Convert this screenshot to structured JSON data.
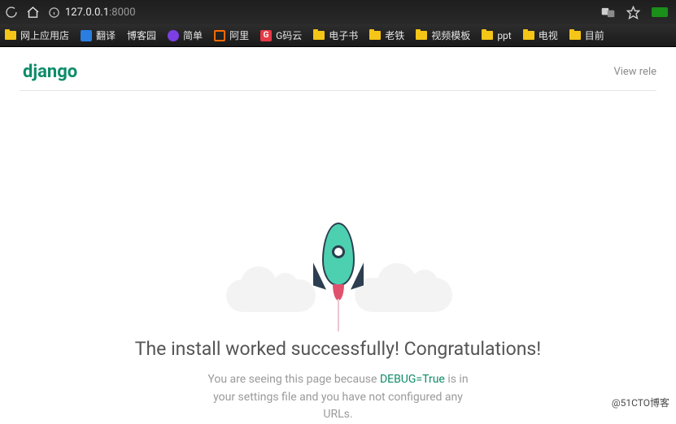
{
  "browser": {
    "url_host": "127.0.0.1",
    "url_port": ":8000"
  },
  "bookmarks": [
    {
      "label": "网上应用店",
      "icon": "folder"
    },
    {
      "label": "翻译",
      "icon": "blue"
    },
    {
      "label": "博客园",
      "icon": "none"
    },
    {
      "label": "简单",
      "icon": "purple"
    },
    {
      "label": "阿里",
      "icon": "orange"
    },
    {
      "label": "G码云",
      "icon": "red",
      "glyph": "G"
    },
    {
      "label": "电子书",
      "icon": "folder"
    },
    {
      "label": "老铁",
      "icon": "folder"
    },
    {
      "label": "视频模板",
      "icon": "folder"
    },
    {
      "label": "ppt",
      "icon": "folder"
    },
    {
      "label": "电视",
      "icon": "folder"
    },
    {
      "label": "目前",
      "icon": "folder"
    }
  ],
  "page": {
    "brand": "django",
    "release_link": "View rele",
    "headline": "The install worked successfully! Congratulations!",
    "sub_before": "You are seeing this page because ",
    "sub_debug": "DEBUG=True",
    "sub_after1": " is in",
    "sub_line2": "your settings file and you have not configured any",
    "sub_line3": "URLs."
  },
  "watermark": "@51CTO博客"
}
